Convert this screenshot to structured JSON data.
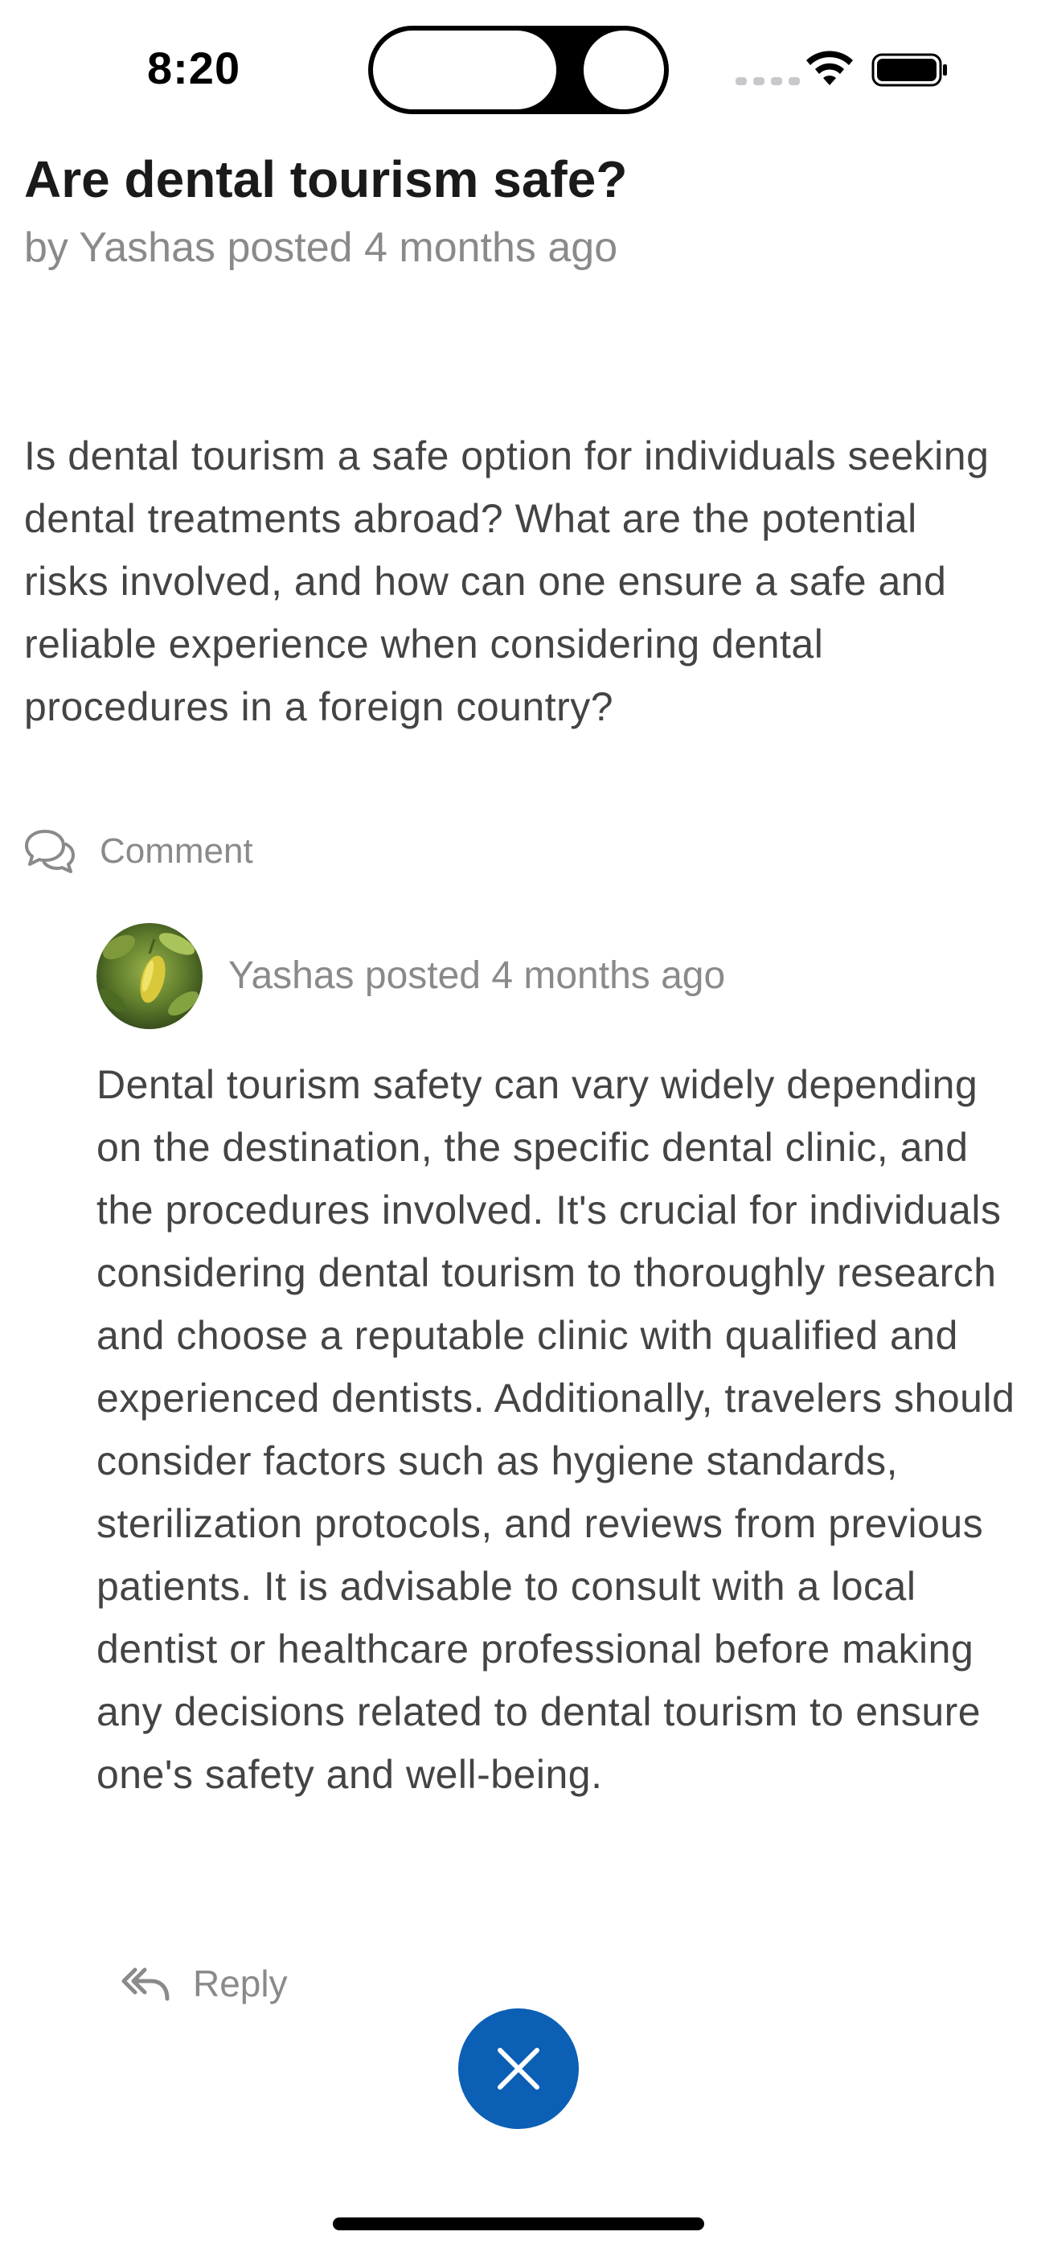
{
  "status_bar": {
    "time": "8:20"
  },
  "post": {
    "title": "Are dental tourism safe?",
    "meta": "by Yashas posted 4 months ago",
    "body": "Is dental tourism a safe option for individuals seeking dental treatments abroad? What are the potential risks involved, and how can one ensure a safe and reliable experience when considering dental procedures in a foreign country?",
    "comment_label": "Comment",
    "comment_icon": "chat-bubbles-icon"
  },
  "answer": {
    "avatar_icon": "avatar-photo",
    "meta": "Yashas posted 4 months ago",
    "body": "Dental tourism safety can vary widely depending on the destination, the specific dental clinic, and the procedures involved. It's crucial for individuals considering dental tourism to thoroughly research and choose a reputable clinic with qualified and experienced dentists. Additionally, travelers should consider factors such as hygiene standards, sterilization protocols, and reviews from previous patients. It is advisable to consult with a local dentist or healthcare professional before making any decisions related to dental tourism to ensure one's safety and well-being.",
    "reply_label": "Reply",
    "reply_icon": "reply-all-icon"
  },
  "fab": {
    "icon": "close-icon",
    "color": "#0b5fb5"
  }
}
